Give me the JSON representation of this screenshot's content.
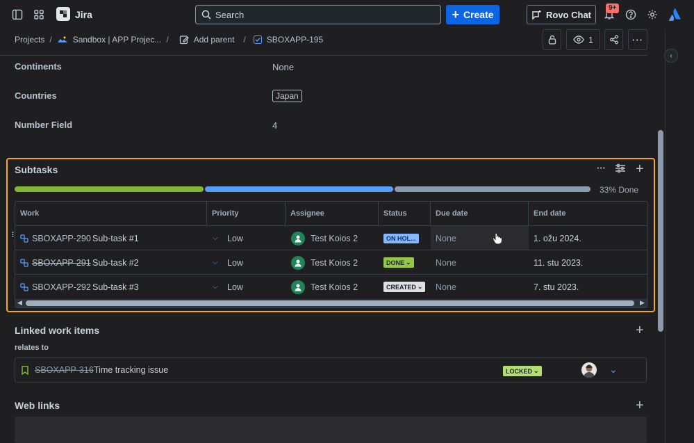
{
  "app": {
    "name": "Jira"
  },
  "search": {
    "placeholder": "Search"
  },
  "topbar": {
    "create_label": "Create",
    "rovo_label": "Rovo Chat",
    "notifications_badge": "9+"
  },
  "breadcrumb": {
    "projects": "Projects",
    "project": "Sandbox | APP Projec...",
    "add_parent": "Add parent",
    "issue_key": "SBOXAPP-195",
    "watch_count": "1"
  },
  "fields": [
    {
      "label": "Continents",
      "value": "None"
    },
    {
      "label": "Countries",
      "value": "Japan"
    },
    {
      "label": "Number Field",
      "value": "4"
    }
  ],
  "subtasks": {
    "title": "Subtasks",
    "progress": {
      "done_fraction": 0.33,
      "in_progress_fraction": 0.33,
      "todo_fraction": 0.34,
      "label": "33% Done"
    },
    "columns": [
      "Work",
      "Priority",
      "Assignee",
      "Status",
      "Due date",
      "End date"
    ],
    "rows": [
      {
        "key": "SBOXAPP-290",
        "summary": "Sub-task #1",
        "done": false,
        "priority": "Low",
        "assignee": "Test Koios 2",
        "status": "ON HOL...",
        "status_color": "#85b8ff",
        "due": "None",
        "end": "1. ožu 2024."
      },
      {
        "key": "SBOXAPP-291",
        "summary": "Sub-task #2",
        "done": true,
        "priority": "Low",
        "assignee": "Test Koios 2",
        "status": "DONE",
        "status_color": "#94c748",
        "due": "None",
        "end": "11. stu 2023."
      },
      {
        "key": "SBOXAPP-292",
        "summary": "Sub-task #3",
        "done": false,
        "priority": "Low",
        "assignee": "Test Koios 2",
        "status": "CREATED",
        "status_color": "#dcdfe4",
        "due": "None",
        "end": "7. stu 2023."
      }
    ]
  },
  "linked": {
    "title": "Linked work items",
    "relation": "relates to",
    "item": {
      "key": "SBOXAPP-316",
      "summary": "Time tracking issue",
      "status": "LOCKED",
      "status_color": "#b3df72"
    }
  },
  "web_links": {
    "title": "Web links"
  },
  "colors": {
    "accent": "#0c66e4",
    "highlight": "#f5a623",
    "progress_done": "#82b536",
    "progress_in_progress": "#579dff",
    "progress_todo": "#8c9bab"
  }
}
